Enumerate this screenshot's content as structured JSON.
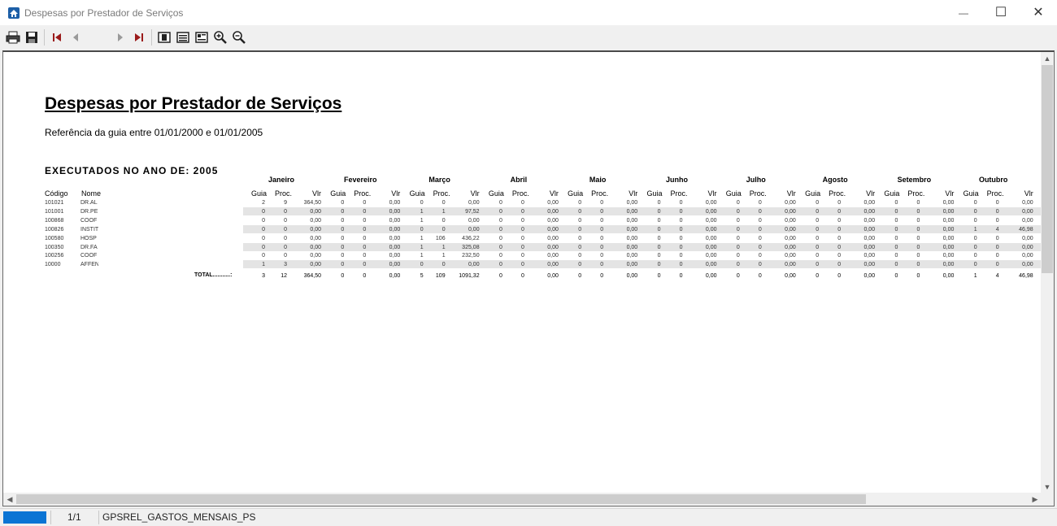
{
  "window": {
    "title": "Despesas por Prestador de Serviços",
    "minimize": "—",
    "maximize": "☐",
    "close": "✕"
  },
  "toolbar": {
    "items": [
      "print-icon",
      "save-icon",
      "first-page-icon",
      "prev-page-icon",
      "page-number-input",
      "next-page-icon",
      "last-page-icon",
      "single-page-icon",
      "multi-page-icon",
      "page-setup-icon",
      "zoom-in-icon",
      "zoom-out-icon"
    ],
    "page_value": ""
  },
  "report": {
    "title": "Despesas por Prestador de Serviços",
    "subtitle": "Referência da guia entre 01/01/2000 e 01/01/2005",
    "section": "EXECUTADOS NO ANO DE: 2005",
    "col_codigo": "Código",
    "col_nome": "Nome",
    "months": [
      "Janeiro",
      "Fevereiro",
      "Março",
      "Abril",
      "Maio",
      "Junho",
      "Julho",
      "Agosto",
      "Setembro",
      "Outubro"
    ],
    "sub_headers": {
      "guia": "Guia",
      "proc": "Proc.",
      "vlr": "Vlr"
    },
    "rows": [
      {
        "codigo": "101021",
        "nome": "DR.AL",
        "values": [
          [
            "2",
            "9",
            "364,50"
          ],
          [
            "0",
            "0",
            "0,00"
          ],
          [
            "0",
            "0",
            "0,00"
          ],
          [
            "0",
            "0",
            "0,00"
          ],
          [
            "0",
            "0",
            "0,00"
          ],
          [
            "0",
            "0",
            "0,00"
          ],
          [
            "0",
            "0",
            "0,00"
          ],
          [
            "0",
            "0",
            "0,00"
          ],
          [
            "0",
            "0",
            "0,00"
          ],
          [
            "0",
            "0",
            "0,00"
          ]
        ]
      },
      {
        "codigo": "101001",
        "nome": "DR.PE",
        "values": [
          [
            "0",
            "0",
            "0,00"
          ],
          [
            "0",
            "0",
            "0,00"
          ],
          [
            "1",
            "1",
            "97,52"
          ],
          [
            "0",
            "0",
            "0,00"
          ],
          [
            "0",
            "0",
            "0,00"
          ],
          [
            "0",
            "0",
            "0,00"
          ],
          [
            "0",
            "0",
            "0,00"
          ],
          [
            "0",
            "0",
            "0,00"
          ],
          [
            "0",
            "0",
            "0,00"
          ],
          [
            "0",
            "0",
            "0,00"
          ]
        ]
      },
      {
        "codigo": "100868",
        "nome": "COOF",
        "values": [
          [
            "0",
            "0",
            "0,00"
          ],
          [
            "0",
            "0",
            "0,00"
          ],
          [
            "1",
            "0",
            "0,00"
          ],
          [
            "0",
            "0",
            "0,00"
          ],
          [
            "0",
            "0",
            "0,00"
          ],
          [
            "0",
            "0",
            "0,00"
          ],
          [
            "0",
            "0",
            "0,00"
          ],
          [
            "0",
            "0",
            "0,00"
          ],
          [
            "0",
            "0",
            "0,00"
          ],
          [
            "0",
            "0",
            "0,00"
          ]
        ]
      },
      {
        "codigo": "100826",
        "nome": "INSTIT",
        "values": [
          [
            "0",
            "0",
            "0,00"
          ],
          [
            "0",
            "0",
            "0,00"
          ],
          [
            "0",
            "0",
            "0,00"
          ],
          [
            "0",
            "0",
            "0,00"
          ],
          [
            "0",
            "0",
            "0,00"
          ],
          [
            "0",
            "0",
            "0,00"
          ],
          [
            "0",
            "0",
            "0,00"
          ],
          [
            "0",
            "0",
            "0,00"
          ],
          [
            "0",
            "0",
            "0,00"
          ],
          [
            "1",
            "4",
            "46,98"
          ]
        ]
      },
      {
        "codigo": "100580",
        "nome": "HOSP",
        "values": [
          [
            "0",
            "0",
            "0,00"
          ],
          [
            "0",
            "0",
            "0,00"
          ],
          [
            "1",
            "106",
            "436,22"
          ],
          [
            "0",
            "0",
            "0,00"
          ],
          [
            "0",
            "0",
            "0,00"
          ],
          [
            "0",
            "0",
            "0,00"
          ],
          [
            "0",
            "0",
            "0,00"
          ],
          [
            "0",
            "0",
            "0,00"
          ],
          [
            "0",
            "0",
            "0,00"
          ],
          [
            "0",
            "0",
            "0,00"
          ]
        ]
      },
      {
        "codigo": "100350",
        "nome": "DR.FA",
        "values": [
          [
            "0",
            "0",
            "0,00"
          ],
          [
            "0",
            "0",
            "0,00"
          ],
          [
            "1",
            "1",
            "325,08"
          ],
          [
            "0",
            "0",
            "0,00"
          ],
          [
            "0",
            "0",
            "0,00"
          ],
          [
            "0",
            "0",
            "0,00"
          ],
          [
            "0",
            "0",
            "0,00"
          ],
          [
            "0",
            "0",
            "0,00"
          ],
          [
            "0",
            "0",
            "0,00"
          ],
          [
            "0",
            "0",
            "0,00"
          ]
        ]
      },
      {
        "codigo": "100256",
        "nome": "COOF",
        "values": [
          [
            "0",
            "0",
            "0,00"
          ],
          [
            "0",
            "0",
            "0,00"
          ],
          [
            "1",
            "1",
            "232,50"
          ],
          [
            "0",
            "0",
            "0,00"
          ],
          [
            "0",
            "0",
            "0,00"
          ],
          [
            "0",
            "0",
            "0,00"
          ],
          [
            "0",
            "0",
            "0,00"
          ],
          [
            "0",
            "0",
            "0,00"
          ],
          [
            "0",
            "0",
            "0,00"
          ],
          [
            "0",
            "0",
            "0,00"
          ]
        ]
      },
      {
        "codigo": "10000",
        "nome": "AFFEN",
        "values": [
          [
            "1",
            "3",
            "0,00"
          ],
          [
            "0",
            "0",
            "0,00"
          ],
          [
            "0",
            "0",
            "0,00"
          ],
          [
            "0",
            "0",
            "0,00"
          ],
          [
            "0",
            "0",
            "0,00"
          ],
          [
            "0",
            "0",
            "0,00"
          ],
          [
            "0",
            "0",
            "0,00"
          ],
          [
            "0",
            "0",
            "0,00"
          ],
          [
            "0",
            "0",
            "0,00"
          ],
          [
            "0",
            "0",
            "0,00"
          ]
        ]
      }
    ],
    "total_label": "TOTAL...........:",
    "totals": [
      [
        "3",
        "12",
        "364,50"
      ],
      [
        "0",
        "0",
        "0,00"
      ],
      [
        "5",
        "109",
        "1091,32"
      ],
      [
        "0",
        "0",
        "0,00"
      ],
      [
        "0",
        "0",
        "0,00"
      ],
      [
        "0",
        "0",
        "0,00"
      ],
      [
        "0",
        "0",
        "0,00"
      ],
      [
        "0",
        "0",
        "0,00"
      ],
      [
        "0",
        "0",
        "0,00"
      ],
      [
        "1",
        "4",
        "46,98"
      ]
    ]
  },
  "status": {
    "page": "1/1",
    "report_name": "GPSREL_GASTOS_MENSAIS_PS"
  },
  "colors": {
    "accent": "#0b74d4",
    "band": "#e4e4e4"
  }
}
